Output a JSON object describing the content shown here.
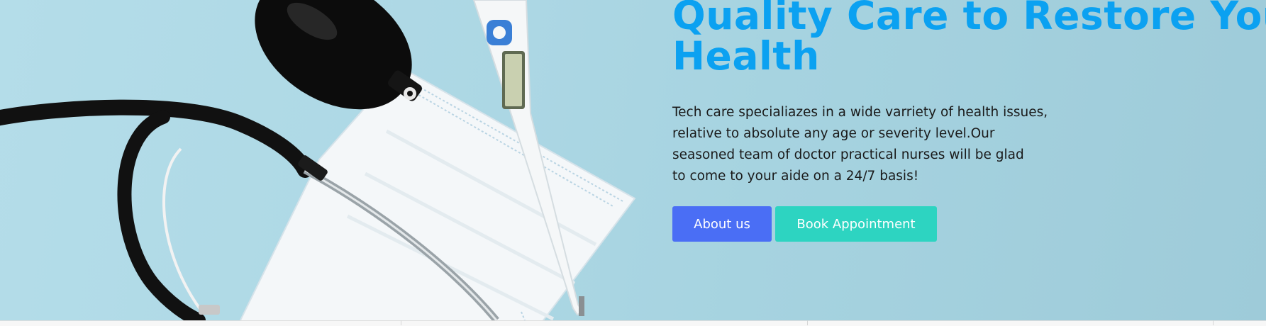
{
  "hero": {
    "headline_line1": "Quality Care to Restore Your",
    "headline_line2": "Health",
    "description_lines": [
      "Tech care specialiazes in a wide varriety of health issues,",
      "relative to absolute any age or severity level.Our",
      "seasoned team of doctor practical nurses will be glad",
      "to come to your aide on a 24/7 basis!"
    ],
    "image_icons": [
      "stethoscope-icon",
      "thermometer-icon",
      "face-mask-icon"
    ]
  },
  "actions": {
    "about_label": "About us",
    "book_label": "Book Appointment"
  },
  "colors": {
    "headline": "#0ba1f1",
    "about_button": "#4a6ef5",
    "book_button": "#2dd4c1",
    "hero_background": "#acd7e4"
  }
}
